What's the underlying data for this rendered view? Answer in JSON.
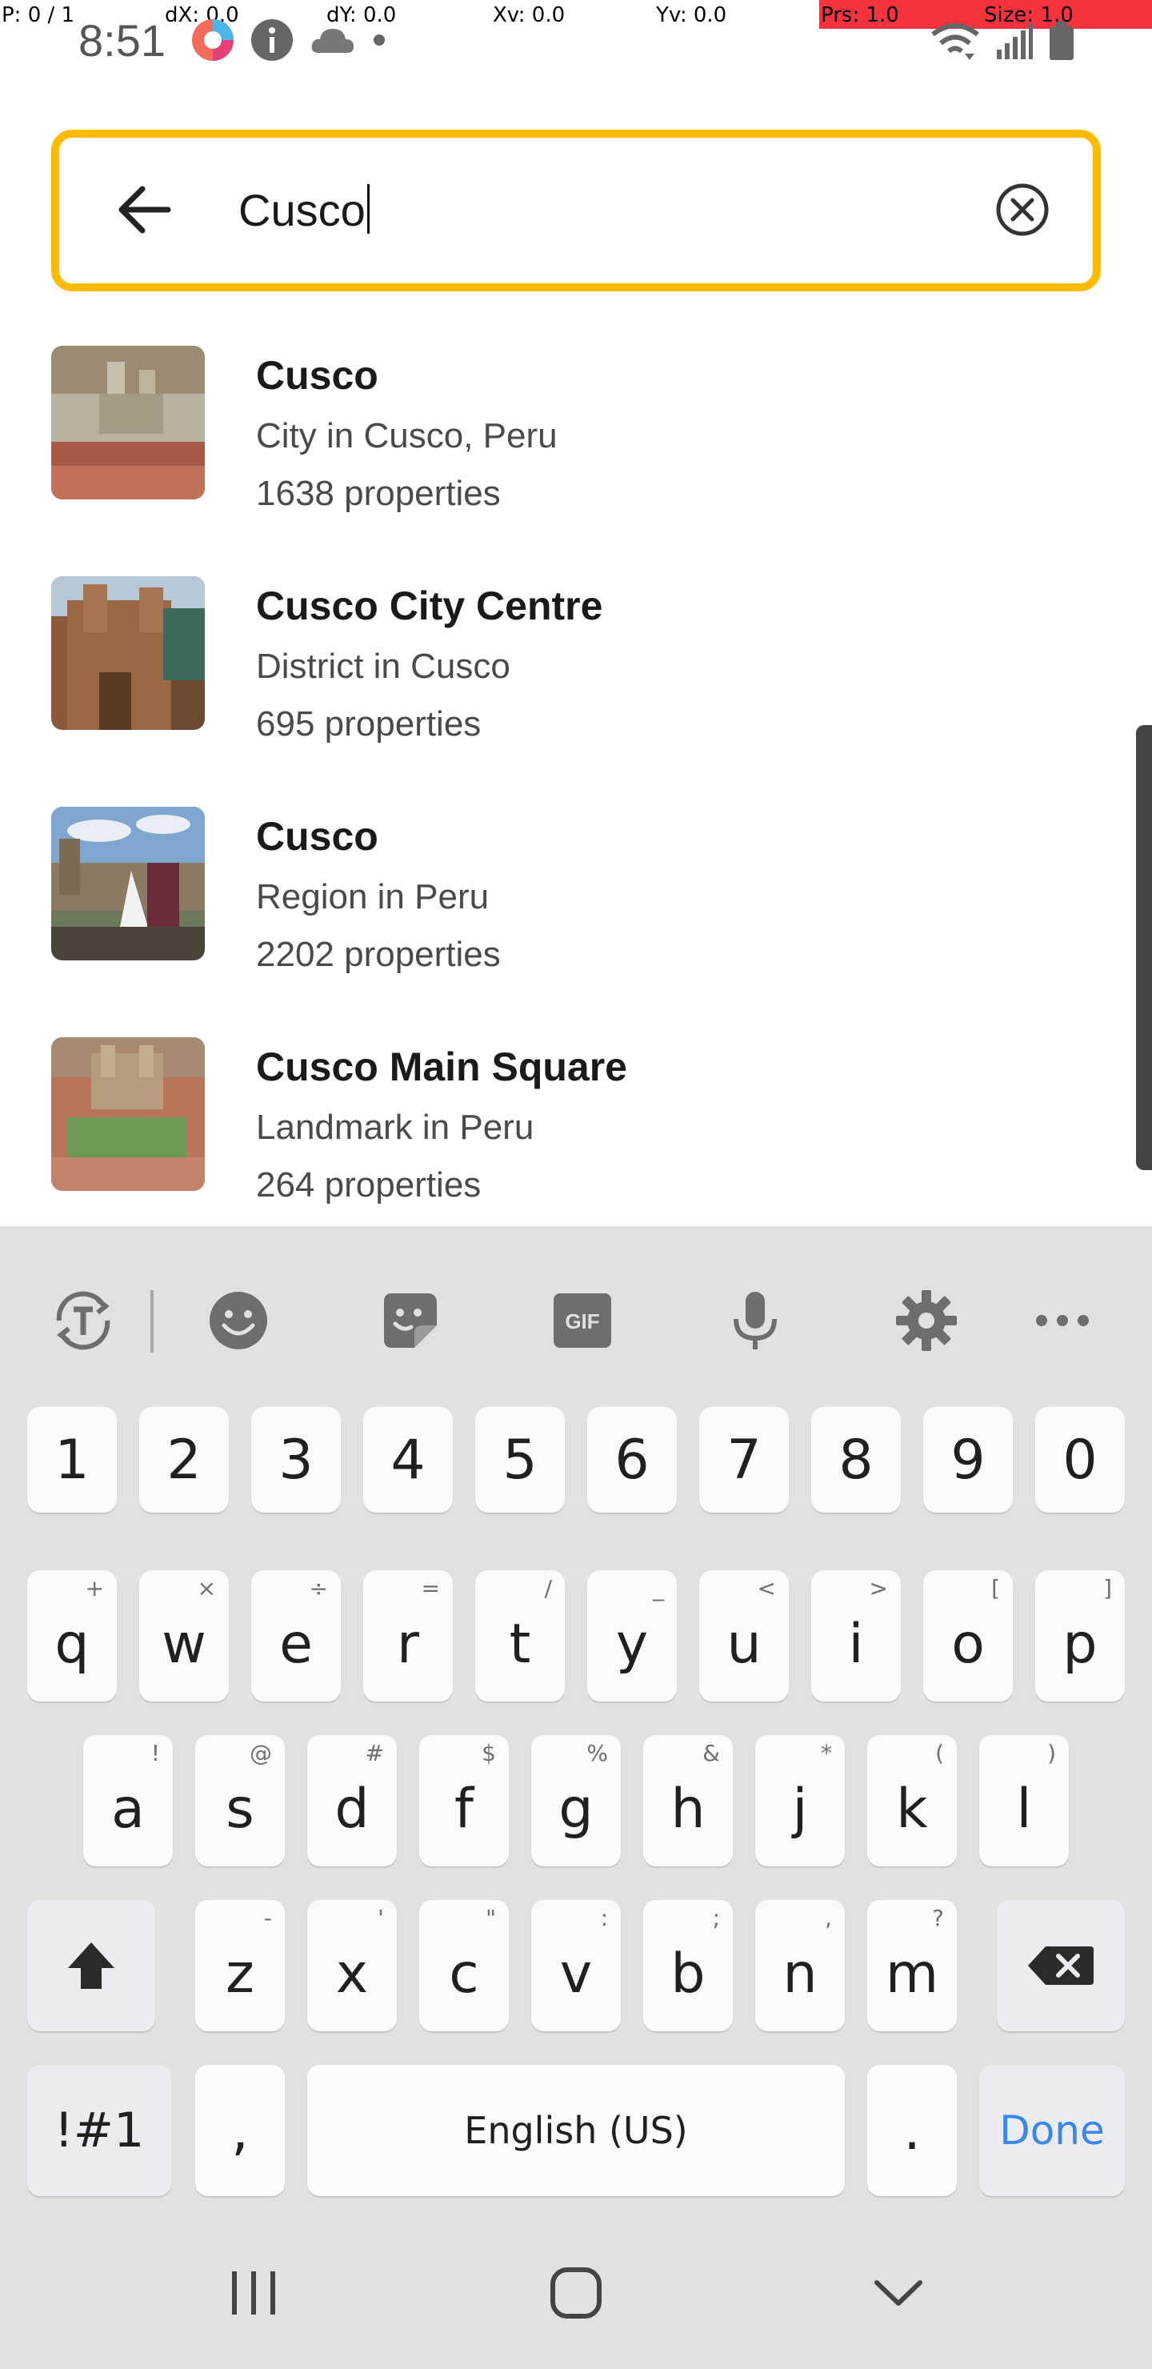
{
  "debug_overlay": {
    "pointer": "P: 0 / 1",
    "dx": "dX: 0.0",
    "dy": "dY: 0.0",
    "xv": "Xv: 0.0",
    "yv": "Yv: 0.0",
    "prs": "Prs: 1.0",
    "size": "Size: 1.0"
  },
  "status_bar": {
    "time": "8:51",
    "left_icons": [
      "app-notification-icon",
      "info-icon",
      "cloud-icon",
      "dot-icon"
    ],
    "right_icons": [
      "wifi-icon",
      "signal-icon",
      "battery-icon"
    ]
  },
  "search": {
    "value": "Cusco",
    "accent_color": "#febb02"
  },
  "results": [
    {
      "title": "Cusco",
      "subtitle": "City in Cusco, Peru",
      "count": "1638 properties"
    },
    {
      "title": "Cusco City Centre",
      "subtitle": "District in Cusco",
      "count": "695 properties"
    },
    {
      "title": "Cusco",
      "subtitle": "Region in Peru",
      "count": "2202 properties"
    },
    {
      "title": "Cusco Main Square",
      "subtitle": "Landmark in Peru",
      "count": "264 properties"
    }
  ],
  "keyboard": {
    "toolbar": [
      "text-translate-icon",
      "emoji-icon",
      "sticker-icon",
      "gif-icon",
      "microphone-icon",
      "settings-gear-icon",
      "more-dots-icon"
    ],
    "gif_label": "GIF",
    "number_row": [
      "1",
      "2",
      "3",
      "4",
      "5",
      "6",
      "7",
      "8",
      "9",
      "0"
    ],
    "row1": [
      {
        "key": "q",
        "sub": "+"
      },
      {
        "key": "w",
        "sub": "×"
      },
      {
        "key": "e",
        "sub": "÷"
      },
      {
        "key": "r",
        "sub": "="
      },
      {
        "key": "t",
        "sub": "/"
      },
      {
        "key": "y",
        "sub": "_"
      },
      {
        "key": "u",
        "sub": "<"
      },
      {
        "key": "i",
        "sub": ">"
      },
      {
        "key": "o",
        "sub": "["
      },
      {
        "key": "p",
        "sub": "]"
      }
    ],
    "row2": [
      {
        "key": "a",
        "sub": "!"
      },
      {
        "key": "s",
        "sub": "@"
      },
      {
        "key": "d",
        "sub": "#"
      },
      {
        "key": "f",
        "sub": "$"
      },
      {
        "key": "g",
        "sub": "%"
      },
      {
        "key": "h",
        "sub": "&"
      },
      {
        "key": "j",
        "sub": "*"
      },
      {
        "key": "k",
        "sub": "("
      },
      {
        "key": "l",
        "sub": ")"
      }
    ],
    "row3": [
      {
        "key": "z",
        "sub": "-"
      },
      {
        "key": "x",
        "sub": "'"
      },
      {
        "key": "c",
        "sub": "\""
      },
      {
        "key": "v",
        "sub": ":"
      },
      {
        "key": "b",
        "sub": ";"
      },
      {
        "key": "n",
        "sub": ","
      },
      {
        "key": "m",
        "sub": "?"
      }
    ],
    "symbols_label": "!#1",
    "comma_label": ",",
    "space_label": "English (US)",
    "period_label": ".",
    "done_label": "Done",
    "done_color": "#3a86ee"
  },
  "nav_bar": [
    "recent-apps-icon",
    "home-icon",
    "back-chevron-icon"
  ]
}
